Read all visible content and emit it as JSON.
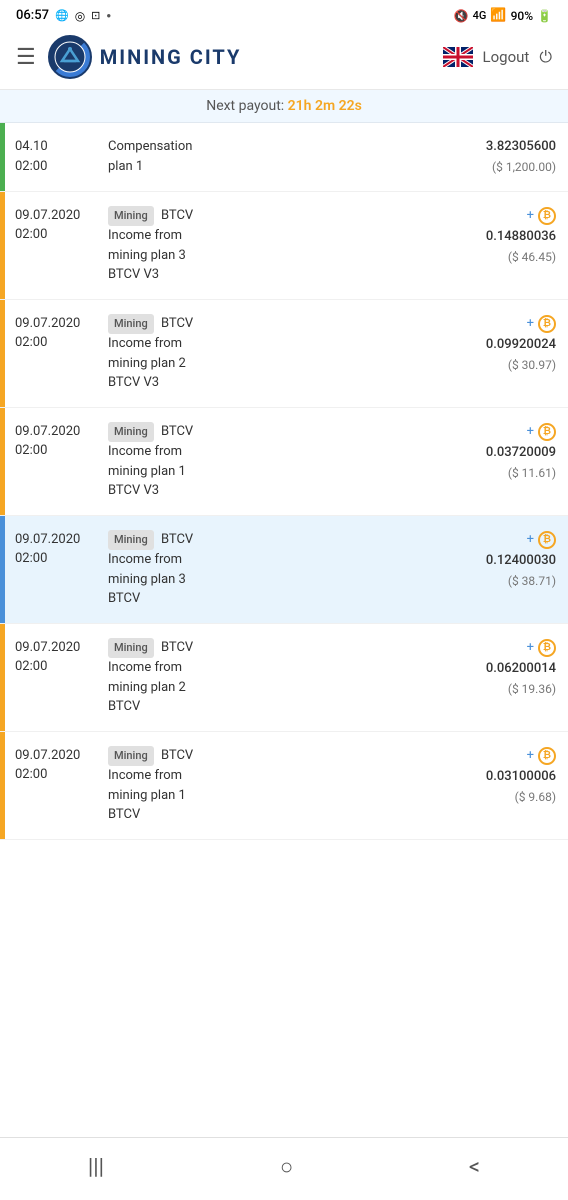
{
  "statusBar": {
    "time": "06:57",
    "battery": "90%",
    "signal": "4G"
  },
  "header": {
    "appName": "MINING CITY",
    "logoutLabel": "Logout"
  },
  "payoutBanner": {
    "label": "Next payout:",
    "time": "21h 2m 22s"
  },
  "transactions": [
    {
      "id": 1,
      "date": "04.10",
      "time": "02:00",
      "badge": "",
      "description": "Compensation\nplan 1",
      "coin": "",
      "amount": "3.82305600",
      "usd": "($ 1,200.00)",
      "sideColor": "green",
      "highlighted": false,
      "showPlus": false
    },
    {
      "id": 2,
      "date": "09.07.2020",
      "time": "02:00",
      "badge": "Mining",
      "coin": "BTCV",
      "description": "Income from\nmining plan 3\nBTCV V3",
      "amount": "0.14880036",
      "usd": "($ 46.45)",
      "sideColor": "yellow",
      "highlighted": false,
      "showPlus": true
    },
    {
      "id": 3,
      "date": "09.07.2020",
      "time": "02:00",
      "badge": "Mining",
      "coin": "BTCV",
      "description": "Income from\nmining plan 2\nBTCV V3",
      "amount": "0.09920024",
      "usd": "($ 30.97)",
      "sideColor": "yellow",
      "highlighted": false,
      "showPlus": true
    },
    {
      "id": 4,
      "date": "09.07.2020",
      "time": "02:00",
      "badge": "Mining",
      "coin": "BTCV",
      "description": "Income from\nmining plan 1\nBTCV V3",
      "amount": "0.03720009",
      "usd": "($ 11.61)",
      "sideColor": "yellow",
      "highlighted": false,
      "showPlus": true
    },
    {
      "id": 5,
      "date": "09.07.2020",
      "time": "02:00",
      "badge": "Mining",
      "coin": "BTCV",
      "description": "Income from\nmining plan 3\nBTCV",
      "amount": "0.12400030",
      "usd": "($ 38.71)",
      "sideColor": "blue",
      "highlighted": true,
      "showPlus": true
    },
    {
      "id": 6,
      "date": "09.07.2020",
      "time": "02:00",
      "badge": "Mining",
      "coin": "BTCV",
      "description": "Income from\nmining plan 2\nBTCV",
      "amount": "0.06200014",
      "usd": "($ 19.36)",
      "sideColor": "yellow",
      "highlighted": false,
      "showPlus": true
    },
    {
      "id": 7,
      "date": "09.07.2020",
      "time": "02:00",
      "badge": "Mining",
      "coin": "BTCV",
      "description": "Income from\nmining plan 1\nBTCV",
      "amount": "0.03100006",
      "usd": "($ 9.68)",
      "sideColor": "yellow",
      "highlighted": false,
      "showPlus": true
    }
  ],
  "bottomNav": {
    "menuIcon": "|||",
    "homeIcon": "○",
    "backIcon": "<"
  }
}
